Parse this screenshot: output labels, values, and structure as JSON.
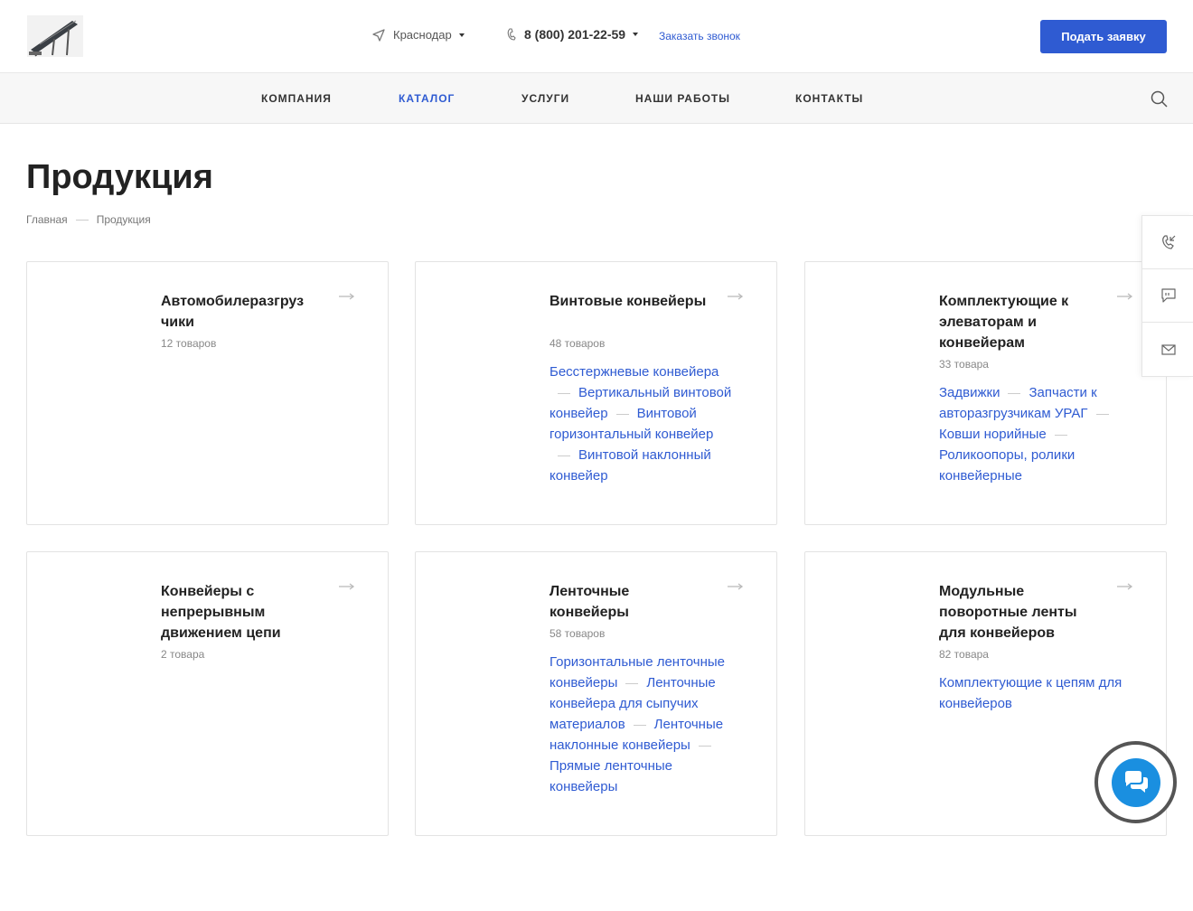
{
  "header": {
    "city": "Краснодар",
    "phone": "8 (800) 201-22-59",
    "callback_label": "Заказать звонок",
    "apply_button": "Подать заявку"
  },
  "nav": {
    "items": [
      {
        "label": "КОМПАНИЯ"
      },
      {
        "label": "КАТАЛОГ",
        "active": true
      },
      {
        "label": "УСЛУГИ"
      },
      {
        "label": "НАШИ РАБОТЫ"
      },
      {
        "label": "КОНТАКТЫ"
      }
    ]
  },
  "page": {
    "title": "Продукция",
    "breadcrumb": [
      "Главная",
      "Продукция"
    ]
  },
  "cards": [
    {
      "title": "Автомобилеразгруз чики",
      "count": "12 товаров",
      "links": []
    },
    {
      "title": "Винтовые конвейеры",
      "count": "48 товаров",
      "links": [
        "Бесстержневые конвейера",
        "Вертикальный винтовой конвейер",
        "Винтовой горизонтальный конвейер",
        "Винтовой наклонный конвейер"
      ]
    },
    {
      "title": "Комплектующие к элеваторам и конвейерам",
      "count": "33 товара",
      "links": [
        "Задвижки",
        "Запчасти к авторазгрузчикам УРАГ",
        "Ковши норийные",
        "Роликоопоры, ролики конвейерные"
      ]
    },
    {
      "title": "Конвейеры с непрерывным движением цепи",
      "count": "2 товара",
      "links": []
    },
    {
      "title": "Ленточные конвейеры",
      "count": "58 товаров",
      "links": [
        "Горизонтальные ленточные конвейеры",
        "Ленточные конвейера для сыпучих материалов",
        "Ленточные наклонные конвейеры",
        "Прямые ленточные конвейеры"
      ]
    },
    {
      "title": "Модульные поворотные ленты для конвейеров",
      "count": "82 товара",
      "links": [
        "Комплектующие к цепям для конвейеров"
      ]
    }
  ],
  "colors": {
    "accent": "#2f5bd2",
    "chat": "#1a8fe0"
  },
  "icons": {
    "logo": "conveyor-logo",
    "city": "location-arrow-icon",
    "phone": "phone-icon",
    "search": "search-icon",
    "side": [
      "callback-phone-icon",
      "chat-message-icon",
      "mail-icon"
    ],
    "chat": "chat-bubble-icon"
  }
}
